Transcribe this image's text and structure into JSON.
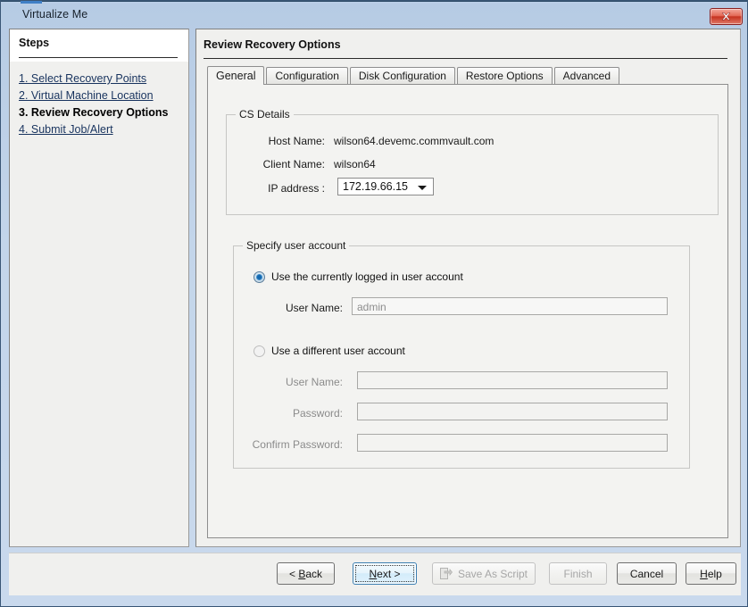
{
  "window": {
    "title": "Virtualize Me",
    "close_label": "×"
  },
  "sidebar": {
    "heading": "Steps",
    "items": [
      {
        "label": "1. Select Recovery Points",
        "current": false
      },
      {
        "label": "2. Virtual Machine Location",
        "current": false
      },
      {
        "label": "3. Review Recovery Options",
        "current": true
      },
      {
        "label": "4. Submit Job/Alert",
        "current": false
      }
    ]
  },
  "main": {
    "title": "Review Recovery Options",
    "tabs": [
      {
        "label": "General",
        "active": true
      },
      {
        "label": "Configuration",
        "active": false
      },
      {
        "label": "Disk Configuration",
        "active": false
      },
      {
        "label": "Restore Options",
        "active": false
      },
      {
        "label": "Advanced",
        "active": false
      }
    ],
    "cs_details": {
      "legend": "CS Details",
      "host_name_label": "Host Name:",
      "host_name_value": "wilson64.devemc.commvault.com",
      "client_name_label": "Client Name:",
      "client_name_value": "wilson64",
      "ip_label": "IP address :",
      "ip_value": "172.19.66.15",
      "ip_options": [
        "172.19.66.15"
      ]
    },
    "user_account": {
      "legend": "Specify user account",
      "option_current_label": "Use the currently logged in user account",
      "option_current_selected": true,
      "current_username_label": "User Name:",
      "current_username_value": "admin",
      "option_different_label": "Use a different user account",
      "option_different_selected": false,
      "different_username_label": "User Name:",
      "different_username_value": "",
      "password_label": "Password:",
      "password_value": "",
      "confirm_password_label": "Confirm Password:",
      "confirm_password_value": ""
    }
  },
  "footer": {
    "back": {
      "pre": "< ",
      "accel": "B",
      "post": "ack",
      "disabled": false
    },
    "next": {
      "accel": "N",
      "post": "ext >",
      "disabled": false,
      "focused": true
    },
    "save_as_script": {
      "label": "Save As Script",
      "disabled": true
    },
    "finish": {
      "label": "Finish",
      "disabled": true
    },
    "cancel": {
      "label": "Cancel",
      "disabled": false
    },
    "help": {
      "accel": "H",
      "post": "elp",
      "disabled": false
    }
  }
}
